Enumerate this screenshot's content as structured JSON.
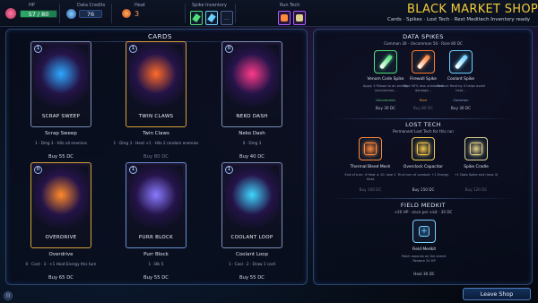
{
  "hud": {
    "hp_label": "HP",
    "hp_value": "57 / 80",
    "credits_label": "Data Credits",
    "credits_value": "76",
    "heat_label": "Heat",
    "heat_value": "3",
    "spike_inventory_label": "Spike Inventory",
    "run_tech_label": "Run Tech"
  },
  "title": "BLACK MARKET SHOP",
  "subtitle": "Cards · Spikes · Lost Tech · Rest Meditech   Inventory ready",
  "cards_section": {
    "title": "CARDS",
    "cards": [
      {
        "art_title": "Scrap Sweep",
        "cost": "1",
        "name": "Scrap Sweep",
        "desc": "1 · Dmg 3 · Hits all enemies",
        "buy": "Buy  55 DC",
        "border": "#7a8fb8",
        "glow": "#2fa8ff",
        "bought": false
      },
      {
        "art_title": "Twin Claws",
        "cost": "1",
        "name": "Twin Claws",
        "desc": "1 · Dmg 3 · Heat +1 · Hits 2 random enemies",
        "buy": "Buy  80 DC",
        "border": "#d6a23c",
        "glow": "#ff6a2a",
        "bought": true
      },
      {
        "art_title": "Neko Dash",
        "cost": "0",
        "name": "Neko Dash",
        "desc": "0 · Dmg 3",
        "buy": "Buy  40 DC",
        "border": "#7a8fb8",
        "glow": "#ff3a8a",
        "bought": false
      },
      {
        "art_title": "Overdrive",
        "cost": "0",
        "name": "Overdrive",
        "desc": "0 · Cost · 3 · +1 Heat Energy this turn",
        "buy": "Buy  65 DC",
        "border": "#d6a23c",
        "glow": "#ff8a2a",
        "bought": false
      },
      {
        "art_title": "Purr Block",
        "cost": "1",
        "name": "Purr Block",
        "desc": "1 · Blk 5",
        "buy": "Buy  55 DC",
        "border": "#6a90d6",
        "glow": "#8a7aff",
        "bought": false
      },
      {
        "art_title": "Coolant Loop",
        "cost": "1",
        "name": "Coolant Loop",
        "desc": "1 · Cool · 2 · Draw 1 card",
        "buy": "Buy  55 DC",
        "border": "#7a8fb8",
        "glow": "#3fd6ff",
        "bought": false
      }
    ]
  },
  "data_spikes": {
    "title": "DATA SPIKES",
    "subtitle": "Common 30 · Uncommon 50 · Rare 80 DC",
    "items": [
      {
        "name": "Venom Code Spike",
        "desc": "Apply 3 Poison to an enemy (uncommon...",
        "rarity": "Uncommon",
        "rarity_color": "#5fd67a",
        "buy": "Buy  30 DC",
        "bought": false,
        "color": "#4ee07a"
      },
      {
        "name": "Firewall Spike",
        "desc": "Take 50% less unblocked damage...",
        "rarity": "Rare",
        "rarity_color": "#e0a23c",
        "buy": "Buy  80 DC",
        "bought": true,
        "color": "#ff7a2a"
      },
      {
        "name": "Coolant Spike",
        "desc": "Reduce Heat by 4 helps avoid heat...",
        "rarity": "Common",
        "rarity_color": "#8fb0e0",
        "buy": "Buy  30 DC",
        "bought": false,
        "color": "#6ad0ff"
      }
    ]
  },
  "lost_tech": {
    "title": "LOST TECH",
    "subtitle": "Permanent Lost Tech for this run",
    "items": [
      {
        "name": "Thermal Bleed Mesh",
        "desc": "End of turn: if Heat ≥ 10, lose 2 Heat",
        "buy": "Buy  100 DC",
        "bought": true,
        "color": "#ff8a3a"
      },
      {
        "name": "Overclock Capacitor",
        "desc": "First turn of combat: +1 Energy",
        "buy": "Buy  150 DC",
        "bought": false,
        "color": "#f2c84a"
      },
      {
        "name": "Spike Cradle",
        "desc": "+1 Data Spike slot (max 4)",
        "buy": "Buy  120 DC",
        "bought": true,
        "color": "#e0d28a"
      }
    ]
  },
  "field_medkit": {
    "title": "FIELD MEDKIT",
    "subtitle": "+20 HP · once per visit · 30 DC",
    "item": {
      "name": "Field Medkit",
      "desc": "Patch wounds on the street. Restore 20 HP",
      "buy": "Heal  30 DC",
      "color": "#7ad0ff"
    }
  },
  "leave_label": "Leave Shop",
  "watermark": "LIMIT CIRCUIT"
}
